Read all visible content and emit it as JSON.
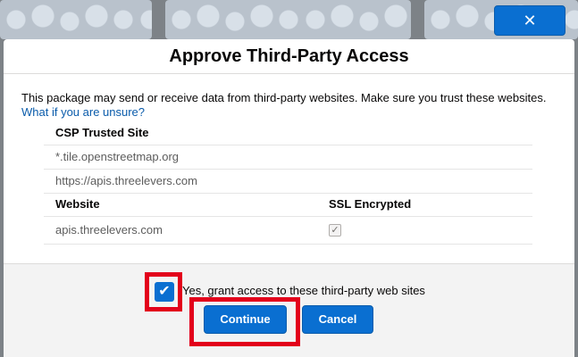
{
  "backdrop": {
    "close_label": "✕"
  },
  "modal": {
    "title": "Approve Third-Party Access",
    "intro": "This package may send or receive data from third-party websites. Make sure you trust these websites.",
    "help_link": "What if you are unsure?",
    "csp_table": {
      "header": "CSP Trusted Site",
      "rows": [
        "*.tile.openstreetmap.org",
        "https://apis.threelevers.com"
      ]
    },
    "website_table": {
      "headers": [
        "Website",
        "SSL Encrypted"
      ],
      "rows": [
        {
          "website": "apis.threelevers.com",
          "ssl_encrypted": true
        }
      ]
    },
    "footer": {
      "grant_label": "Yes, grant access to these third-party web sites",
      "grant_checked": true,
      "continue_label": "Continue",
      "cancel_label": "Cancel"
    }
  },
  "colors": {
    "primary": "#0a6fd1",
    "highlight": "#e3001b"
  }
}
